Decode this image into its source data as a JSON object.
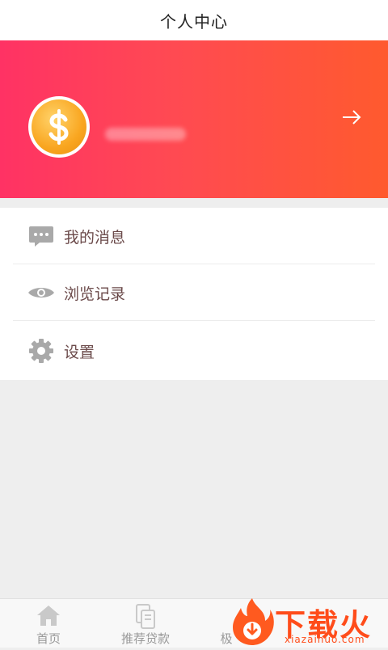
{
  "header": {
    "title": "个人中心"
  },
  "profile": {
    "avatar_icon": "dollar-coin-icon",
    "arrow_icon": "arrow-right-icon"
  },
  "menu": {
    "items": [
      {
        "label": "我的消息",
        "icon": "message-icon"
      },
      {
        "label": "浏览记录",
        "icon": "eye-icon"
      },
      {
        "label": "设置",
        "icon": "gear-icon"
      }
    ]
  },
  "tabbar": {
    "tabs": [
      {
        "label": "首页",
        "icon": "home-icon"
      },
      {
        "label": "推荐贷款",
        "icon": "cards-icon"
      },
      {
        "label": "极",
        "icon": ""
      }
    ]
  },
  "watermark": {
    "title": "下载火",
    "subtitle": "xiazaihuo.com"
  },
  "colors": {
    "banner_start": "#ff3264",
    "banner_end": "#ff5a2e",
    "coin": "#f9a620",
    "brand": "#ff4c1a"
  }
}
